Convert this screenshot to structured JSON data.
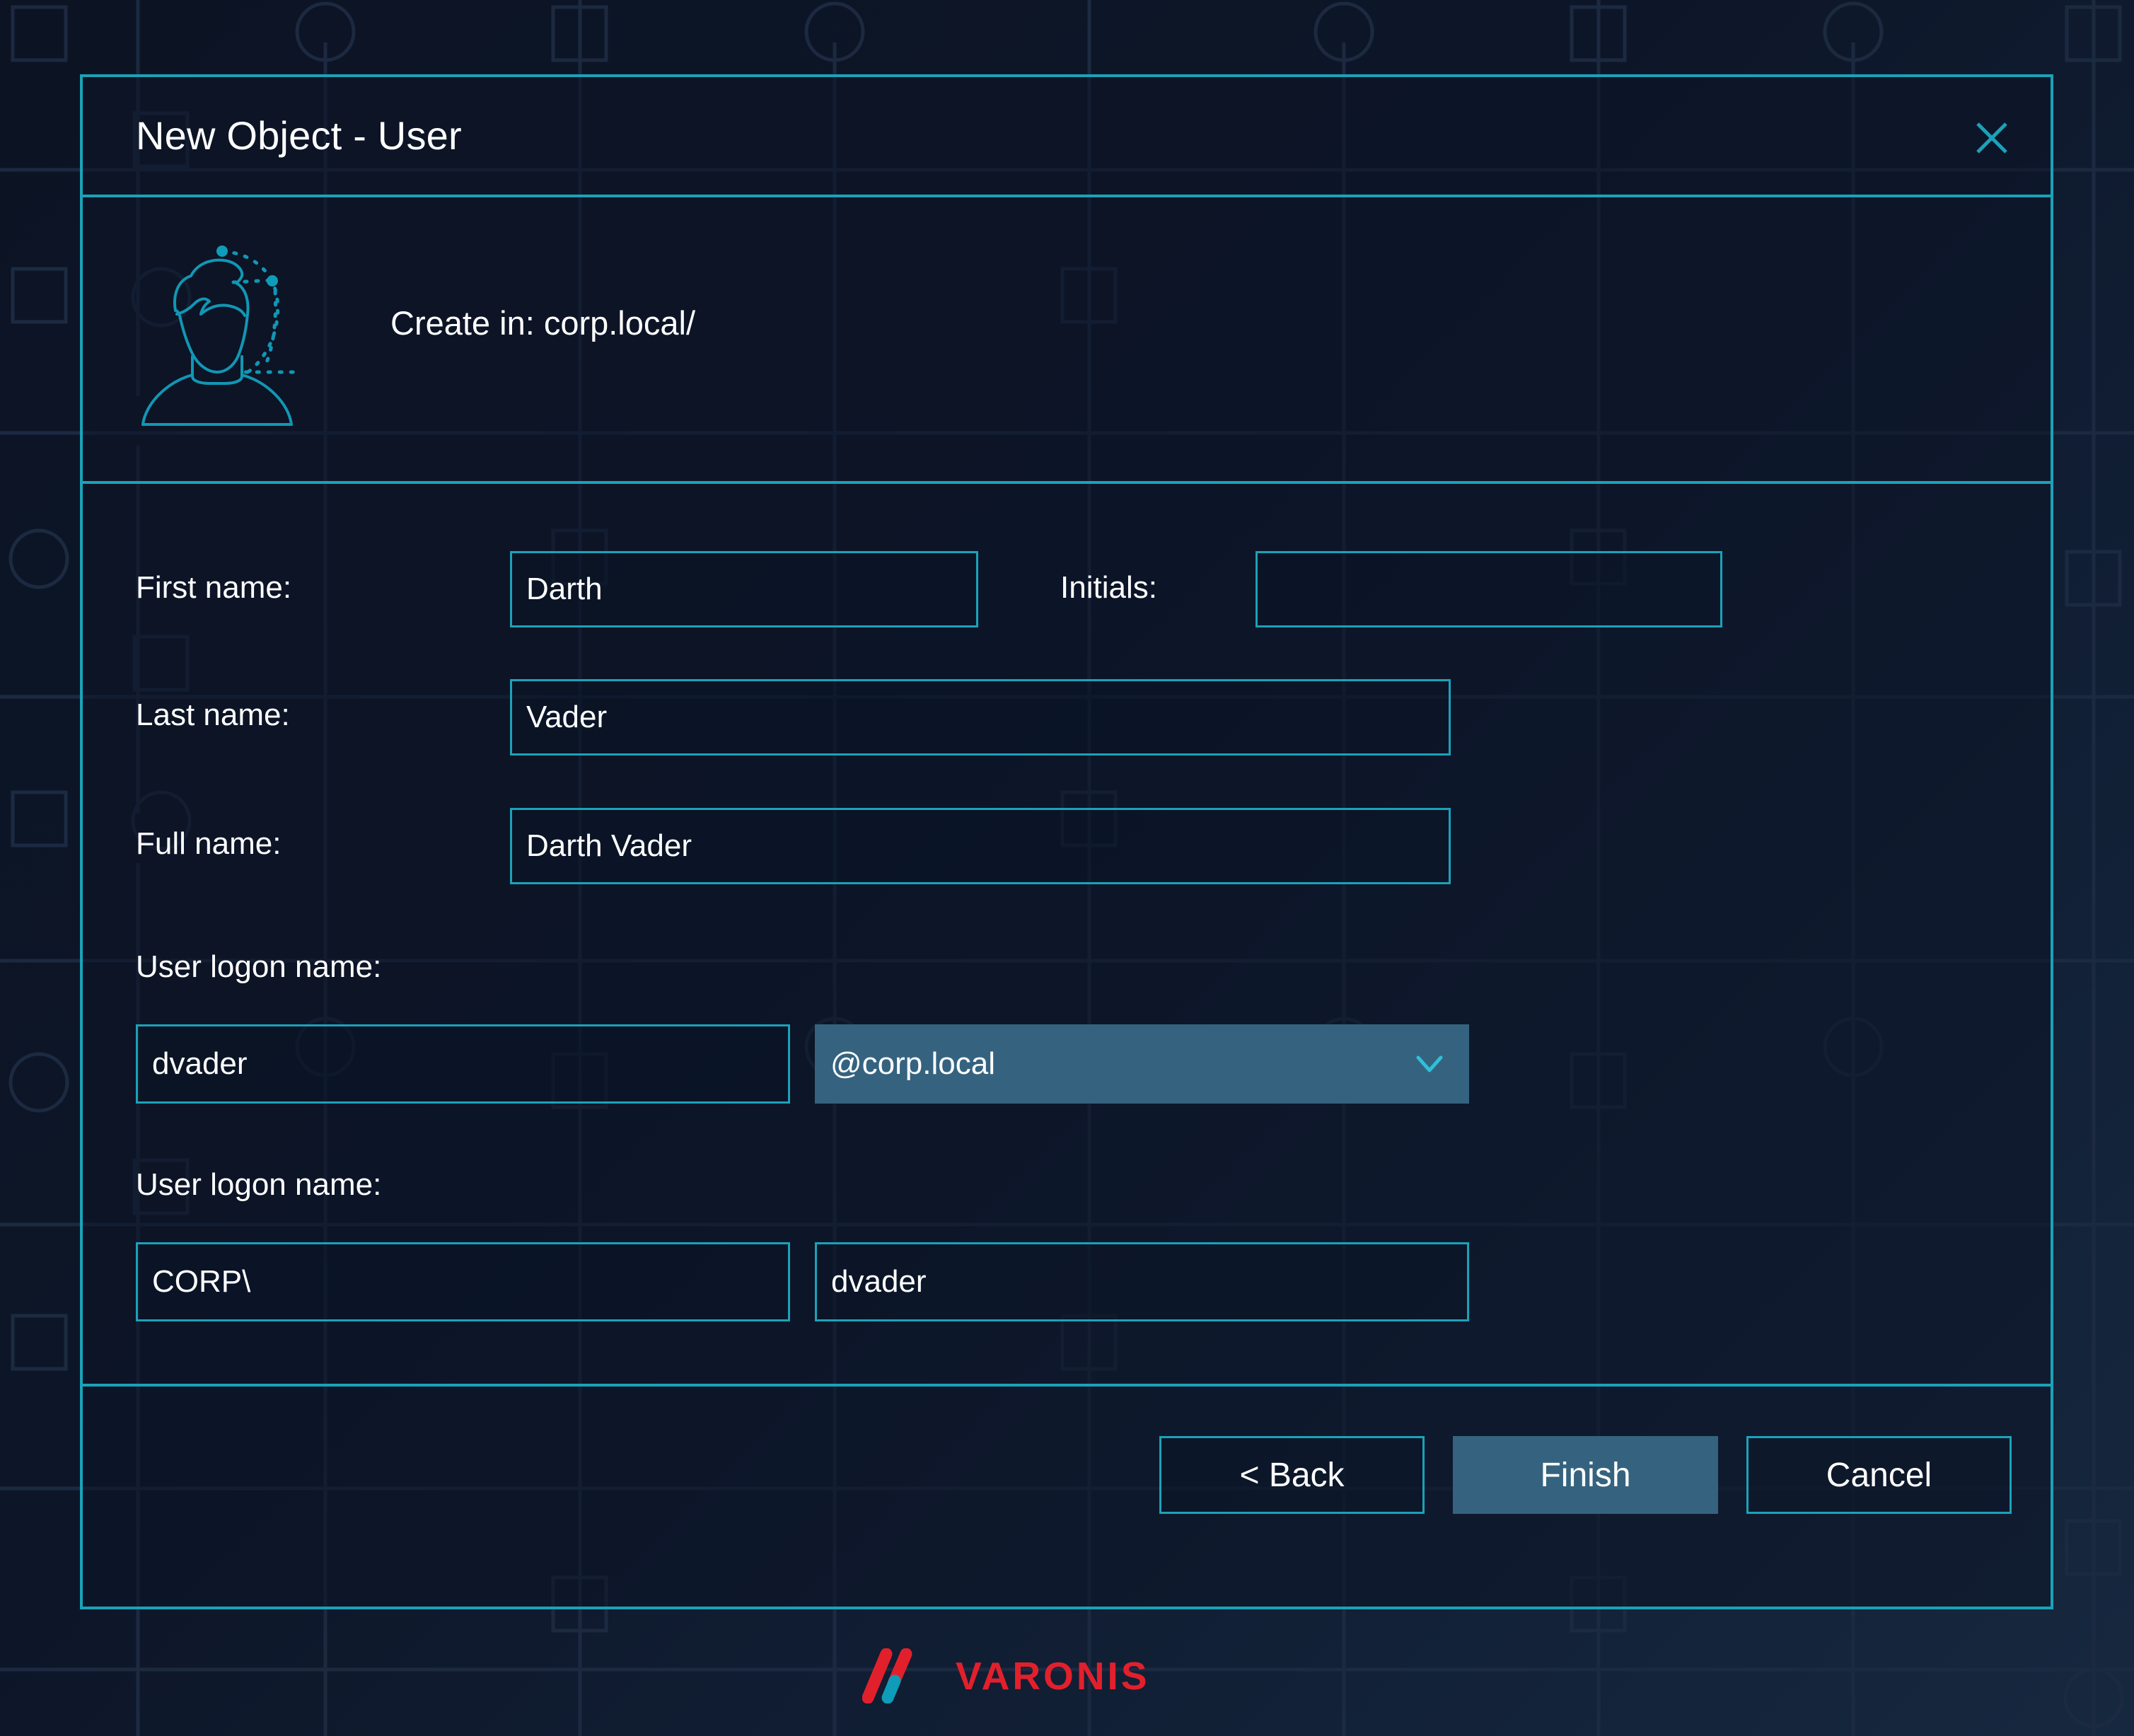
{
  "window": {
    "title": "New Object - User",
    "close_icon": "close-icon"
  },
  "create_in": {
    "text": "Create in: corp.local/",
    "avatar_icon": "user-avatar-icon"
  },
  "form": {
    "fields": [
      {
        "label": "First name:",
        "value": "Darth"
      },
      {
        "label": "Initials:",
        "value": ""
      },
      {
        "label": "Last name:",
        "value": "Vader"
      },
      {
        "label": "Full name:",
        "value": "Darth Vader"
      }
    ],
    "upn_section": {
      "label": "User logon name:",
      "prefix_value": "dvader",
      "suffix_value": "@corp.local",
      "suffix_chevron_icon": "chevron-down-icon"
    },
    "sam_section": {
      "label": "User logon name:",
      "domain_value": "CORP\\",
      "name_value": "dvader"
    }
  },
  "footer": {
    "back_label": "< Back",
    "finish_label": "Finish",
    "cancel_label": "Cancel"
  },
  "branding": {
    "wordmark": "VARONIS",
    "logo_icon": "varonis-slash-logo"
  },
  "colors": {
    "accent_cyan": "#1ba2b8",
    "dialog_bg": "#0d1628",
    "page_bg": "#0c1526",
    "dropdown_fill": "#35637f",
    "brand_red": "#e2202c",
    "brand_cyan": "#0e9cb8",
    "text_primary": "#ffffff"
  }
}
